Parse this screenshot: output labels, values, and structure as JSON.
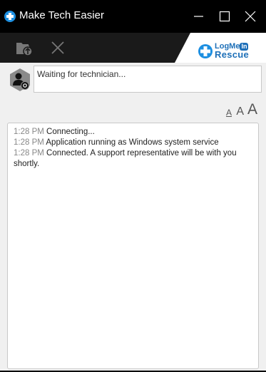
{
  "window": {
    "title": "Make Tech Easier",
    "app_icon": "logmein-rescue-cross-icon",
    "controls": {
      "minimize": "minimize-icon",
      "maximize": "maximize-icon",
      "close": "close-icon"
    }
  },
  "toolbar": {
    "file_transfer_icon": "folder-upload-icon",
    "close_icon": "close-x-icon",
    "logo": {
      "logme": "LogMe",
      "in": "In",
      "rescue": "Rescue",
      "accent": "#1d6fb8"
    }
  },
  "status": {
    "avatar_icon": "technician-avatar-icon",
    "text": "Waiting for technician..."
  },
  "font_size": {
    "small": "A",
    "medium": "A",
    "large": "A"
  },
  "log": {
    "entries": [
      {
        "time": "1:28 PM",
        "message": "Connecting..."
      },
      {
        "time": "1:28 PM",
        "message": "Application running as Windows system service"
      },
      {
        "time": "1:28 PM",
        "message": "Connected. A support representative will be with you shortly."
      }
    ]
  }
}
